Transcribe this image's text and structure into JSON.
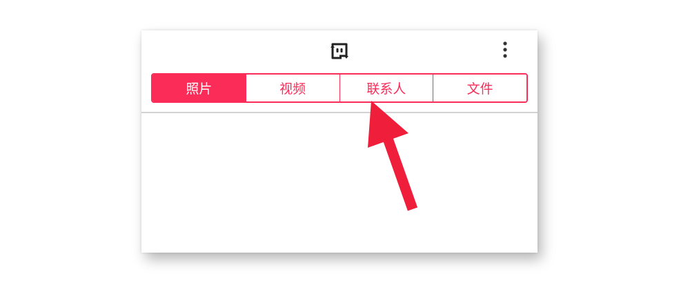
{
  "header": {
    "app_icon": "send-anywhere-logo-icon",
    "menu_icon": "more-vertical-icon"
  },
  "tabs": [
    {
      "label": "照片",
      "active": true
    },
    {
      "label": "视频",
      "active": false
    },
    {
      "label": "联系人",
      "active": false
    },
    {
      "label": "文件",
      "active": false
    }
  ],
  "colors": {
    "accent": "#fb2c58",
    "arrow": "#ef1f3c",
    "divider": "#d2d2d2"
  }
}
